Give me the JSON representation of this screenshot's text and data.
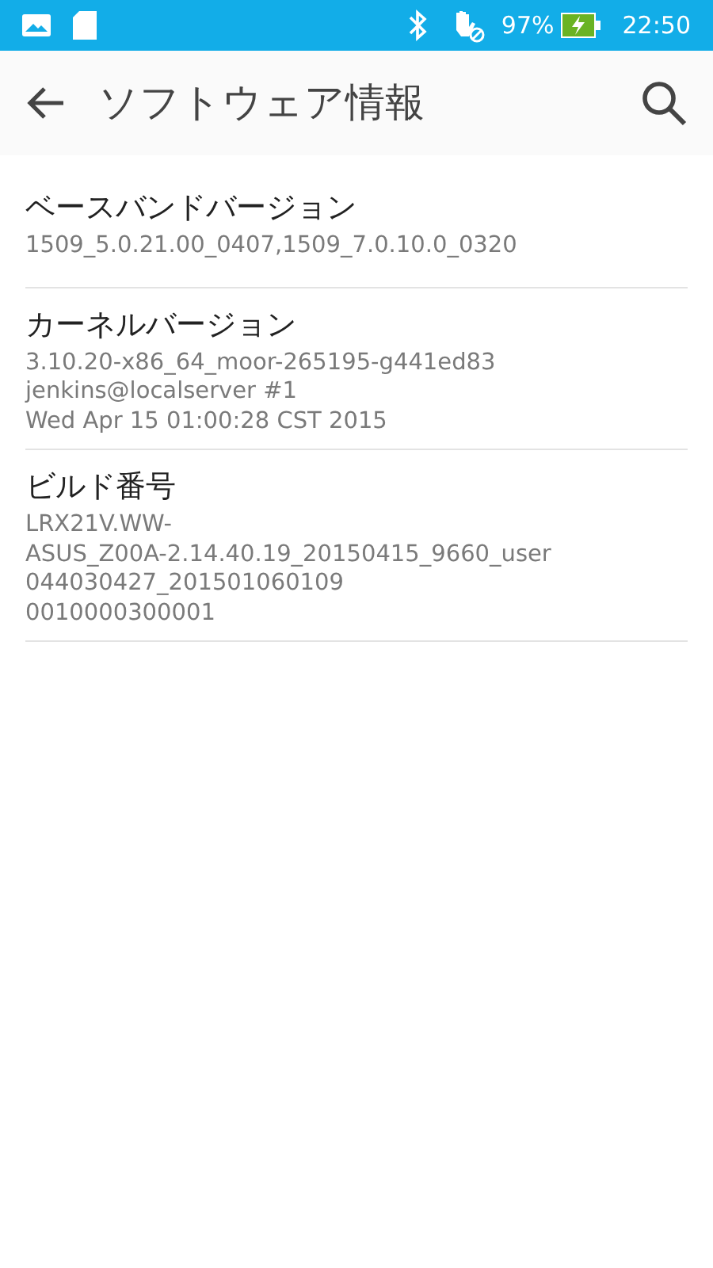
{
  "status_bar": {
    "battery": "97%",
    "time": "22:50"
  },
  "app_bar": {
    "title": "ソフトウェア情報"
  },
  "items": [
    {
      "title": "ベースバンドバージョン",
      "lines": [
        "1509_5.0.21.00_0407,1509_7.0.10.0_0320"
      ]
    },
    {
      "title": "カーネルバージョン",
      "lines": [
        "3.10.20-x86_64_moor-265195-g441ed83",
        "jenkins@localserver #1",
        "Wed Apr 15 01:00:28 CST 2015"
      ]
    },
    {
      "title": "ビルド番号",
      "lines": [
        "LRX21V.WW-",
        "ASUS_Z00A-2.14.40.19_20150415_9660_user",
        "044030427_201501060109",
        "0010000300001"
      ]
    }
  ]
}
